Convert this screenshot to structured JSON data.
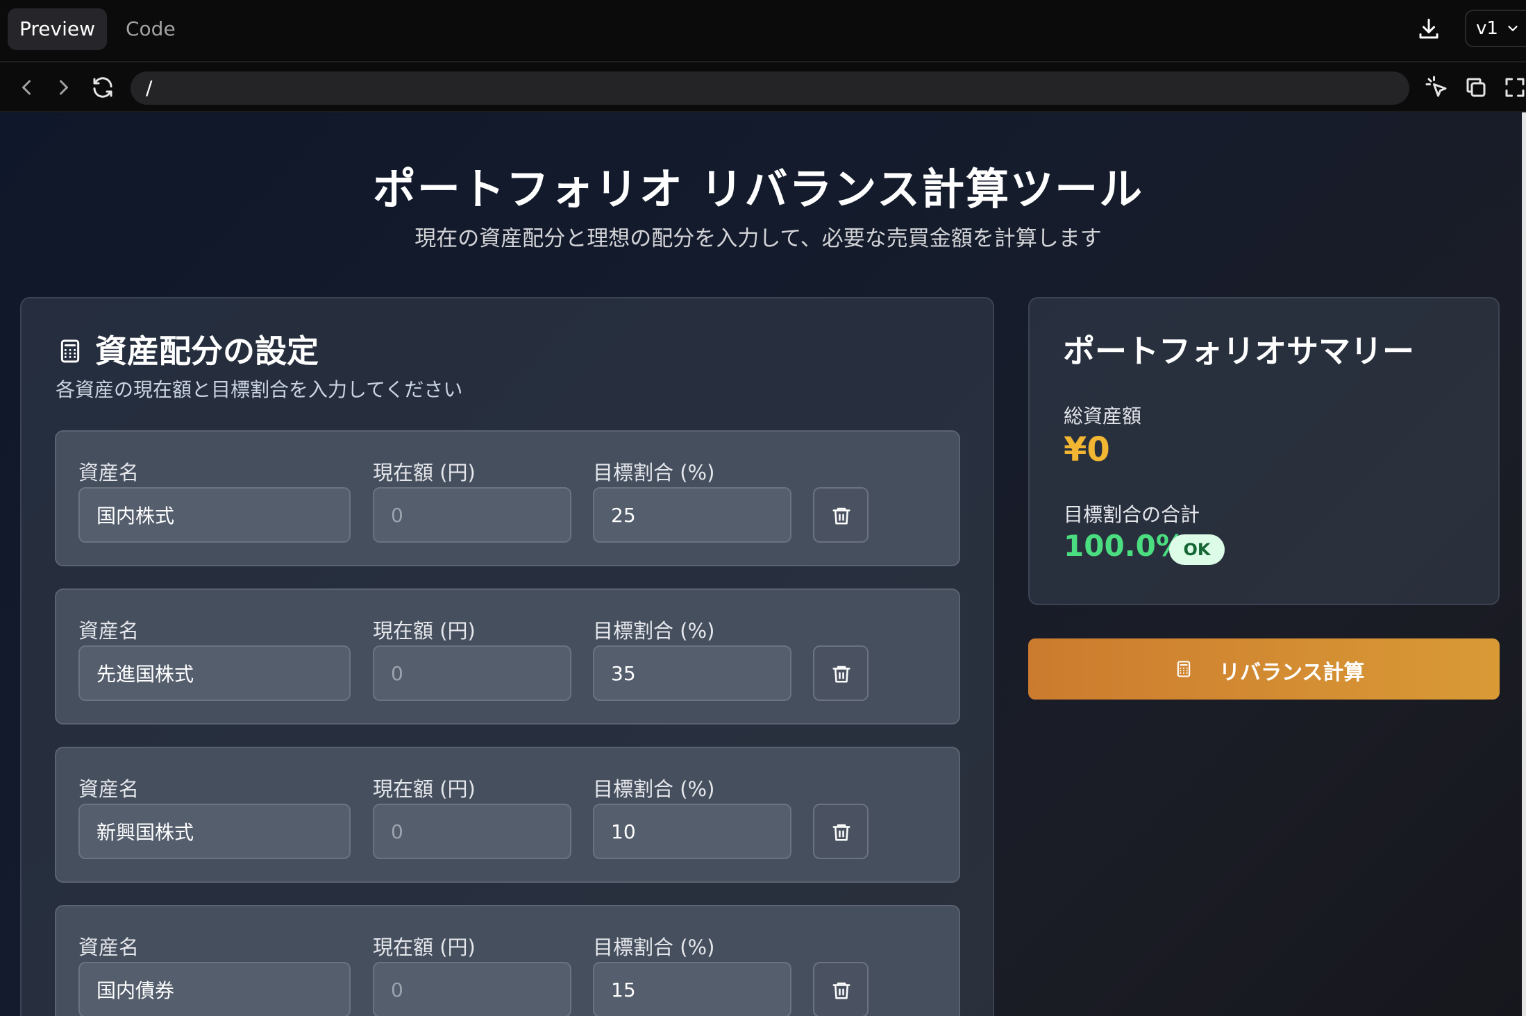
{
  "topbar": {
    "tabs": [
      {
        "label": "Preview",
        "active": true
      },
      {
        "label": "Code",
        "active": false
      }
    ],
    "version": "v1"
  },
  "navbar": {
    "url": "/"
  },
  "page": {
    "title": "ポートフォリオ リバランス計算ツール",
    "subtitle": "現在の資産配分と理想の配分を入力して、必要な売買金額を計算します"
  },
  "settings": {
    "heading": "資産配分の設定",
    "description": "各資産の現在額と目標割合を入力してください",
    "labels": {
      "name": "資産名",
      "amount": "現在額 (円)",
      "target": "目標割合 (%)"
    },
    "rows": [
      {
        "name": "国内株式",
        "amount_placeholder": "0",
        "target": "25"
      },
      {
        "name": "先進国株式",
        "amount_placeholder": "0",
        "target": "35"
      },
      {
        "name": "新興国株式",
        "amount_placeholder": "0",
        "target": "10"
      },
      {
        "name": "国内債券",
        "amount_placeholder": "0",
        "target": "15"
      }
    ]
  },
  "summary": {
    "heading": "ポートフォリオサマリー",
    "total_label": "総資産額",
    "total_value": "¥0",
    "target_sum_label": "目標割合の合計",
    "target_sum_value": "100.0%",
    "status_badge": "OK"
  },
  "actions": {
    "rebalance_label": "リバランス計算"
  },
  "colors": {
    "accent_yellow": "#f2b632",
    "ok_green": "#4ade80",
    "button_orange": "#d08630"
  }
}
